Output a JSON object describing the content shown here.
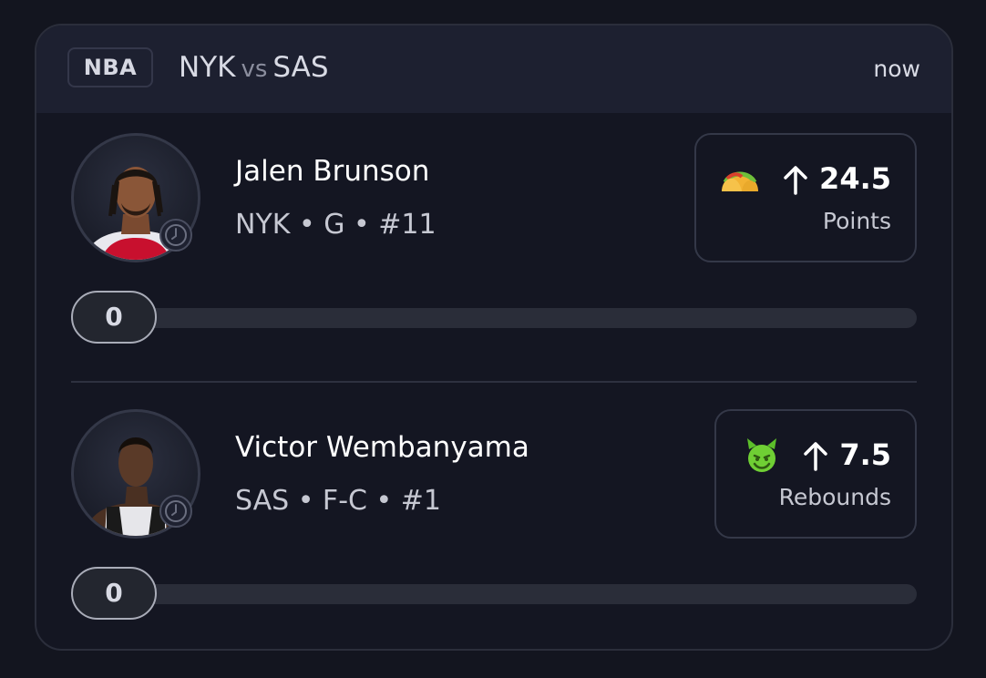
{
  "header": {
    "league": "NBA",
    "home_team": "NYK",
    "vs": "vs",
    "away_team": "SAS",
    "time": "now"
  },
  "players": [
    {
      "name": "Jalen Brunson",
      "meta": "NYK • G • #11",
      "stat_emoji": "taco-emoji",
      "direction": "up-arrow-icon",
      "line": "24.5",
      "stat": "Points",
      "progress_value": "0",
      "progress_fraction": 0
    },
    {
      "name": "Victor Wembanyama",
      "meta": "SAS • F-C • #1",
      "stat_emoji": "green-devil-emoji",
      "direction": "up-arrow-icon",
      "line": "7.5",
      "stat": "Rebounds",
      "progress_value": "0",
      "progress_fraction": 0
    }
  ],
  "colors": {
    "background": "#13151f",
    "card": "#141622",
    "header": "#1d2030",
    "border": "#343848",
    "track": "#2a2d39"
  }
}
